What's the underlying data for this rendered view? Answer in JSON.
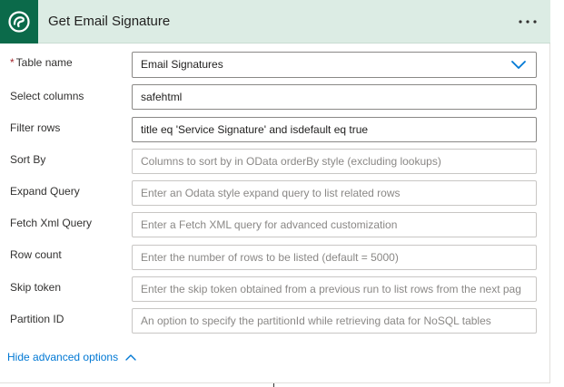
{
  "header": {
    "title": "Get Email Signature",
    "logo_icon": "dataverse-icon",
    "menu_icon": "more-options-icon",
    "accent_color": "#0b6a4a",
    "background_color": "#dcece4"
  },
  "fields": {
    "table_name": {
      "required_marker": "*",
      "label": "Table name",
      "value": "Email Signatures"
    },
    "select_columns": {
      "label": "Select columns",
      "value": "safehtml"
    },
    "filter_rows": {
      "label": "Filter rows",
      "value": "title eq 'Service Signature' and isdefault eq true"
    },
    "sort_by": {
      "label": "Sort By",
      "placeholder": "Columns to sort by in OData orderBy style (excluding lookups)"
    },
    "expand_query": {
      "label": "Expand Query",
      "placeholder": "Enter an Odata style expand query to list related rows"
    },
    "fetch_xml_query": {
      "label": "Fetch Xml Query",
      "placeholder": "Enter a Fetch XML query for advanced customization"
    },
    "row_count": {
      "label": "Row count",
      "placeholder": "Enter the number of rows to be listed (default = 5000)"
    },
    "skip_token": {
      "label": "Skip token",
      "placeholder": "Enter the skip token obtained from a previous run to list rows from the next pag"
    },
    "partition_id": {
      "label": "Partition ID",
      "placeholder": "An option to specify the partitionId while retrieving data for NoSQL tables"
    }
  },
  "footer": {
    "advanced_link": "Hide advanced options",
    "link_color": "#0078d4"
  }
}
